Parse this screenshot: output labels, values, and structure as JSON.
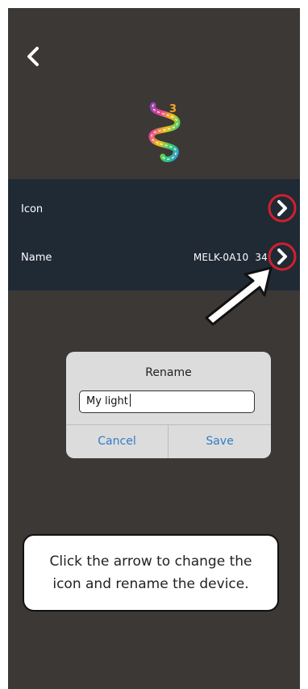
{
  "colors": {
    "screen_bg": "#3c3836",
    "panel_bg": "#1f2a35",
    "highlight_ring": "#d0202e",
    "dialog_accent": "#2f7dc3",
    "badge": "#f5a623"
  },
  "header": {
    "back_icon": "chevron-left-icon"
  },
  "device": {
    "logo_icon": "light-strip-icon",
    "badge": "3"
  },
  "settings": {
    "icon_row": {
      "label": "Icon",
      "arrow_icon": "chevron-right-icon"
    },
    "name_row": {
      "label": "Name",
      "value": "MELK-0A10  34",
      "arrow_icon": "chevron-right-icon"
    }
  },
  "dialog": {
    "title": "Rename",
    "input_value": "My light",
    "cancel_label": "Cancel",
    "save_label": "Save"
  },
  "callout": {
    "line1": "Click the arrow to change the",
    "line2": "icon and rename the device."
  }
}
